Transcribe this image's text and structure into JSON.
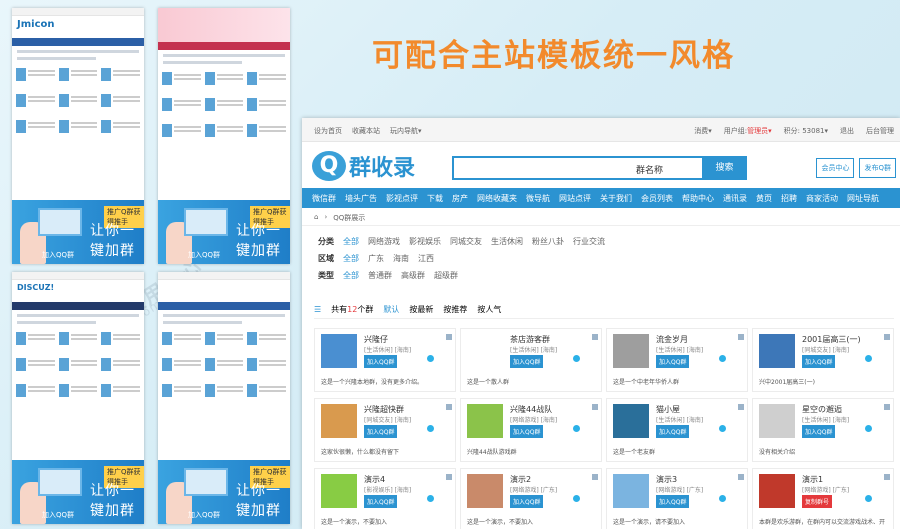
{
  "heading": "可配合主站模板统一风格",
  "watermark": {
    "brand": "DISCUZ!应用中心",
    "url": "addon.dismall.com"
  },
  "thumbnails": [
    {
      "logo": "Jmicon",
      "banner_small": "推广Q群获得推手",
      "banner_big": "让你一键加群",
      "banner_button": "加入QQ群"
    },
    {
      "logo": "",
      "banner_small": "推广Q群获得推手",
      "banner_big": "让你一键加群",
      "banner_button": "加入QQ群"
    },
    {
      "logo": "DISCUZ!",
      "banner_small": "推广Q群获得推手",
      "banner_big": "让你一键加群",
      "banner_button": "加入QQ群"
    },
    {
      "logo": "",
      "banner_small": "推广Q群获得推手",
      "banner_big": "让你一键加群",
      "banner_button": "加入QQ群"
    }
  ],
  "topbar": {
    "left": [
      "设为首页",
      "收藏本站",
      "玩内导航▾"
    ],
    "right": [
      "消费▾",
      "用户组:",
      "管理员▾",
      "积分: 53081▾",
      "退出",
      "后台管理"
    ]
  },
  "logo_text": "群收录",
  "search": {
    "placeholder": "群名称",
    "button": "搜索"
  },
  "header_buttons": [
    "会员中心",
    "发布Q群"
  ],
  "nav": [
    "微信群",
    "墙头广告",
    "影视点评",
    "下载",
    "房产",
    "网络收藏夹",
    "微导航",
    "网站点评",
    "关于我们",
    "会员列表",
    "帮助中心",
    "通讯录",
    "黄页",
    "招聘",
    "商家活动",
    "网址导航"
  ],
  "breadcrumb": [
    "⌂",
    "›",
    "QQ群展示"
  ],
  "filters": [
    {
      "label": "分类",
      "items": [
        "全部",
        "网络游戏",
        "影视娱乐",
        "同城交友",
        "生活休闲",
        "粉丝八卦",
        "行业交流"
      ]
    },
    {
      "label": "区域",
      "items": [
        "全部",
        "广东",
        "海南",
        "江西"
      ]
    },
    {
      "label": "类型",
      "items": [
        "全部",
        "普通群",
        "高级群",
        "超级群"
      ]
    }
  ],
  "sortbar": {
    "prefix": "共有",
    "count": "12",
    "suffix": "个群",
    "options": [
      "默认",
      "按最新",
      "按推荐",
      "按人气"
    ]
  },
  "cards": [
    {
      "name": "兴隆仔",
      "tag": "[生活休闲] [海南]",
      "button": "加入QQ群",
      "desc": "这是一个兴隆本地群，没有更多介绍。"
    },
    {
      "name": "茶店游客群",
      "tag": "[生活休闲] [海南]",
      "button": "加入QQ群",
      "desc": "这是一个散人群"
    },
    {
      "name": "流金岁月",
      "tag": "[生活休闲] [海南]",
      "button": "加入QQ群",
      "desc": "这是一个中老年华侨人群"
    },
    {
      "name": "2001届高三(一)",
      "tag": "[同城交友] [海南]",
      "button": "加入QQ群",
      "desc": "兴中2001届高三(一)"
    },
    {
      "name": "兴隆超快群",
      "tag": "[同城交友] [海南]",
      "button": "加入QQ群",
      "desc": "这家伙很懒，什么都没有留下"
    },
    {
      "name": "兴隆44战队",
      "tag": "[网络游戏] [海南]",
      "button": "加入QQ群",
      "desc": "兴隆44战队游戏群"
    },
    {
      "name": "猫小屋",
      "tag": "[生活休闲] [海南]",
      "button": "加入QQ群",
      "desc": "这是一个老友群"
    },
    {
      "name": "星空の邂逅",
      "tag": "[生活休闲] [海南]",
      "button": "加入QQ群",
      "desc": "没有相关介绍"
    },
    {
      "name": "演示4",
      "tag": "[影视娱乐] [海南]",
      "button": "加入QQ群",
      "desc": "这是一个演示，不要加入"
    },
    {
      "name": "演示2",
      "tag": "[网络游戏] [广东]",
      "button": "加入QQ群",
      "desc": "这是一个演示，不要加入"
    },
    {
      "name": "演示3",
      "tag": "[网络游戏] [广东]",
      "button": "加入QQ群",
      "desc": "这是一个演示，请不要加入"
    },
    {
      "name": "演示1",
      "tag": "[网络游戏] [广东]",
      "button": "复制群号",
      "desc": "本群是欢乐游群，在群内可以交流游戏战术、开"
    }
  ],
  "avatar_colors": [
    "#4a8fd1",
    "#ffffff",
    "#9e9e9e",
    "#3d77b8",
    "#d99a4e",
    "#8bc34a",
    "#2a6f9a",
    "#cfcfcf",
    "#88cc44",
    "#c98a6a",
    "#7bb4e0",
    "#c0392b"
  ]
}
